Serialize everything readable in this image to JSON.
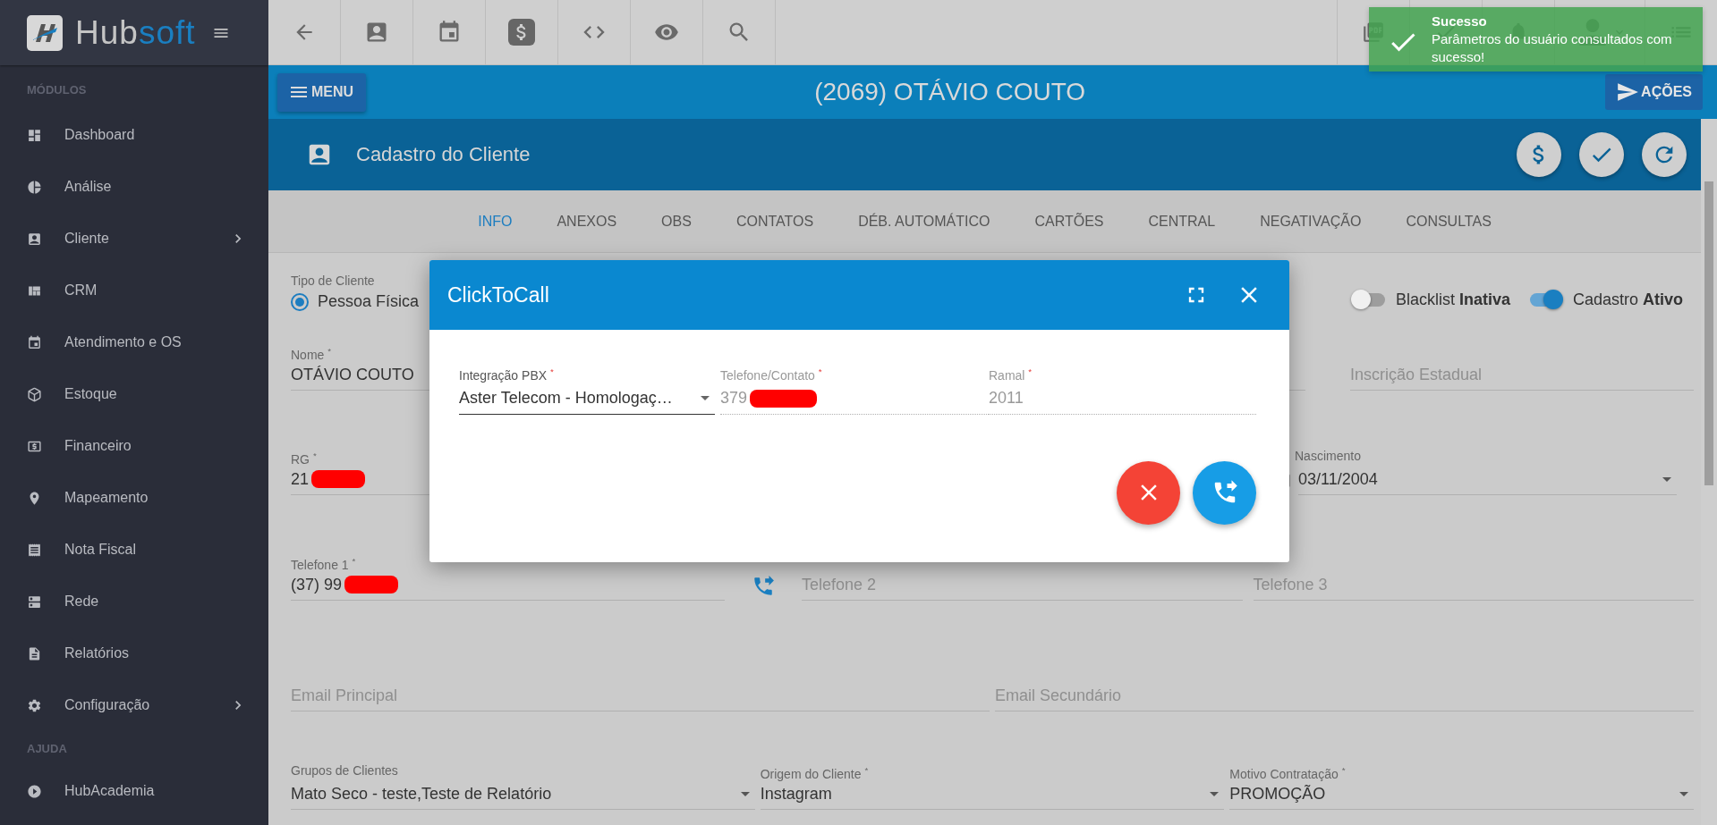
{
  "sidebar": {
    "logo": {
      "part_1": "Hub",
      "part_2": "soft"
    },
    "sections": [
      {
        "heading": "MÓDULOS",
        "items": [
          {
            "label": "Dashboard"
          },
          {
            "label": "Análise"
          },
          {
            "label": "Cliente",
            "has_submenu": true
          },
          {
            "label": "CRM"
          },
          {
            "label": "Atendimento e OS"
          },
          {
            "label": "Estoque"
          },
          {
            "label": "Financeiro"
          },
          {
            "label": "Mapeamento"
          },
          {
            "label": "Nota Fiscal"
          },
          {
            "label": "Rede"
          },
          {
            "label": "Relatórios"
          },
          {
            "label": "Configuração",
            "has_submenu": true
          }
        ]
      },
      {
        "heading": "AJUDA",
        "items": [
          {
            "label": "HubAcademia"
          }
        ]
      }
    ]
  },
  "toast": {
    "title": "Sucesso",
    "message": "Parâmetros do usuário consultados com sucesso!"
  },
  "client_bar": {
    "menu_button": "MENU",
    "title": "(2069) OTÁVIO COUTO",
    "actions_button": "AÇÕES"
  },
  "page_header": {
    "title": "Cadastro do Cliente"
  },
  "tabs": [
    {
      "label": "INFO",
      "selected": true
    },
    {
      "label": "ANEXOS",
      "selected": false
    },
    {
      "label": "OBS",
      "selected": false
    },
    {
      "label": "CONTATOS",
      "selected": false
    },
    {
      "label": "DÉB. AUTOMÁTICO",
      "selected": false
    },
    {
      "label": "CARTÕES",
      "selected": false
    },
    {
      "label": "CENTRAL",
      "selected": false
    },
    {
      "label": "NEGATIVAÇÃO",
      "selected": false
    },
    {
      "label": "CONSULTAS",
      "selected": false
    }
  ],
  "form": {
    "client_type": {
      "label": "Tipo de Cliente",
      "option": "Pessoa Física",
      "selected": true
    },
    "toggles": [
      {
        "label": "Blacklist",
        "state_text": "Inativa",
        "on": false
      },
      {
        "label": "Cadastro",
        "state_text": "Ativo",
        "on": true
      }
    ],
    "rows": [
      {
        "fields": [
          {
            "kind": "text",
            "label": "Nome $^{*}$",
            "value": "OTÁVIO COUTO"
          },
          {
            "kind": "text",
            "placeholder": "Inscrição Estadual"
          }
        ]
      },
      {
        "fields": [
          {
            "kind": "text",
            "label": "RG $^{*}$",
            "value": "21",
            "redacted": true
          },
          {
            "kind": "date",
            "label": "Nascimento",
            "value": "03/11/2004"
          }
        ]
      },
      {
        "fields": [
          {
            "kind": "phone",
            "label": "Telefone 1 $^{*}$",
            "value": "(37) 99",
            "redacted": true
          },
          {
            "kind": "text",
            "placeholder": "Telefone 2"
          },
          {
            "kind": "text",
            "placeholder": "Telefone 3"
          }
        ]
      },
      {
        "fields": [
          {
            "kind": "text",
            "placeholder": "Email Principal"
          },
          {
            "kind": "text",
            "placeholder": "Email Secundário"
          }
        ]
      },
      {
        "fields": [
          {
            "kind": "select",
            "label": "Grupos de Clientes",
            "value": "Mato Seco - teste,Teste de Relatório"
          },
          {
            "kind": "select",
            "label": "Origem do Cliente $^{*}$",
            "value": "Instagram"
          },
          {
            "kind": "select",
            "label": "Motivo Contratação $^{*}$",
            "value": "PROMOÇÃO"
          }
        ]
      }
    ]
  },
  "dialog": {
    "title": "ClickToCall",
    "fields": [
      {
        "kind": "select",
        "label": "Integração PBX $^{*}$",
        "value": "Aster Telecom - Homologaç…"
      },
      {
        "kind": "readonly",
        "label": "Telefone/Contato $^{*}$",
        "value": "379",
        "redacted": true,
        "disabled": true
      },
      {
        "kind": "readonly",
        "label": "Ramal $^{*}$",
        "value": "2011",
        "disabled": true
      }
    ]
  }
}
